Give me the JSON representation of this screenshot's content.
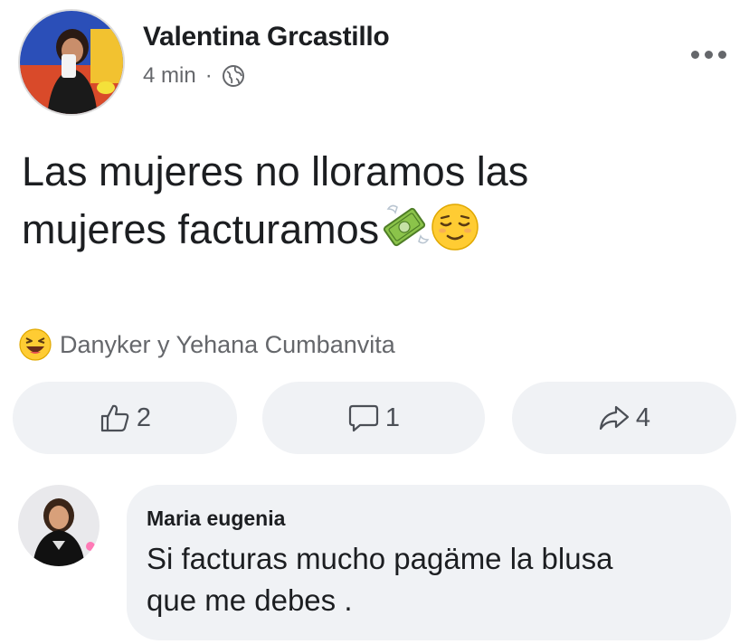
{
  "post": {
    "author": "Valentina Grcastillo",
    "time": "4 min",
    "separator": "·",
    "privacy_icon": "globe-icon",
    "text_line1": "Las mujeres no lloramos las",
    "text_line2": "mujeres facturamos",
    "emojis": [
      "money-with-wings-icon",
      "relieved-face-icon"
    ]
  },
  "reactions": {
    "icon": "laughing-face-icon",
    "names": "Danyker y Yehana Cumbanvita"
  },
  "actions": {
    "like_count": "2",
    "comment_count": "1",
    "share_count": "4"
  },
  "comment": {
    "author": "Maria eugenia",
    "text_line1": "Si facturas mucho pagäme la blusa",
    "text_line2": "que me debes ."
  },
  "colors": {
    "secondary_text": "#65676b",
    "button_bg": "#f0f2f5",
    "primary_text": "#1c1e21"
  }
}
